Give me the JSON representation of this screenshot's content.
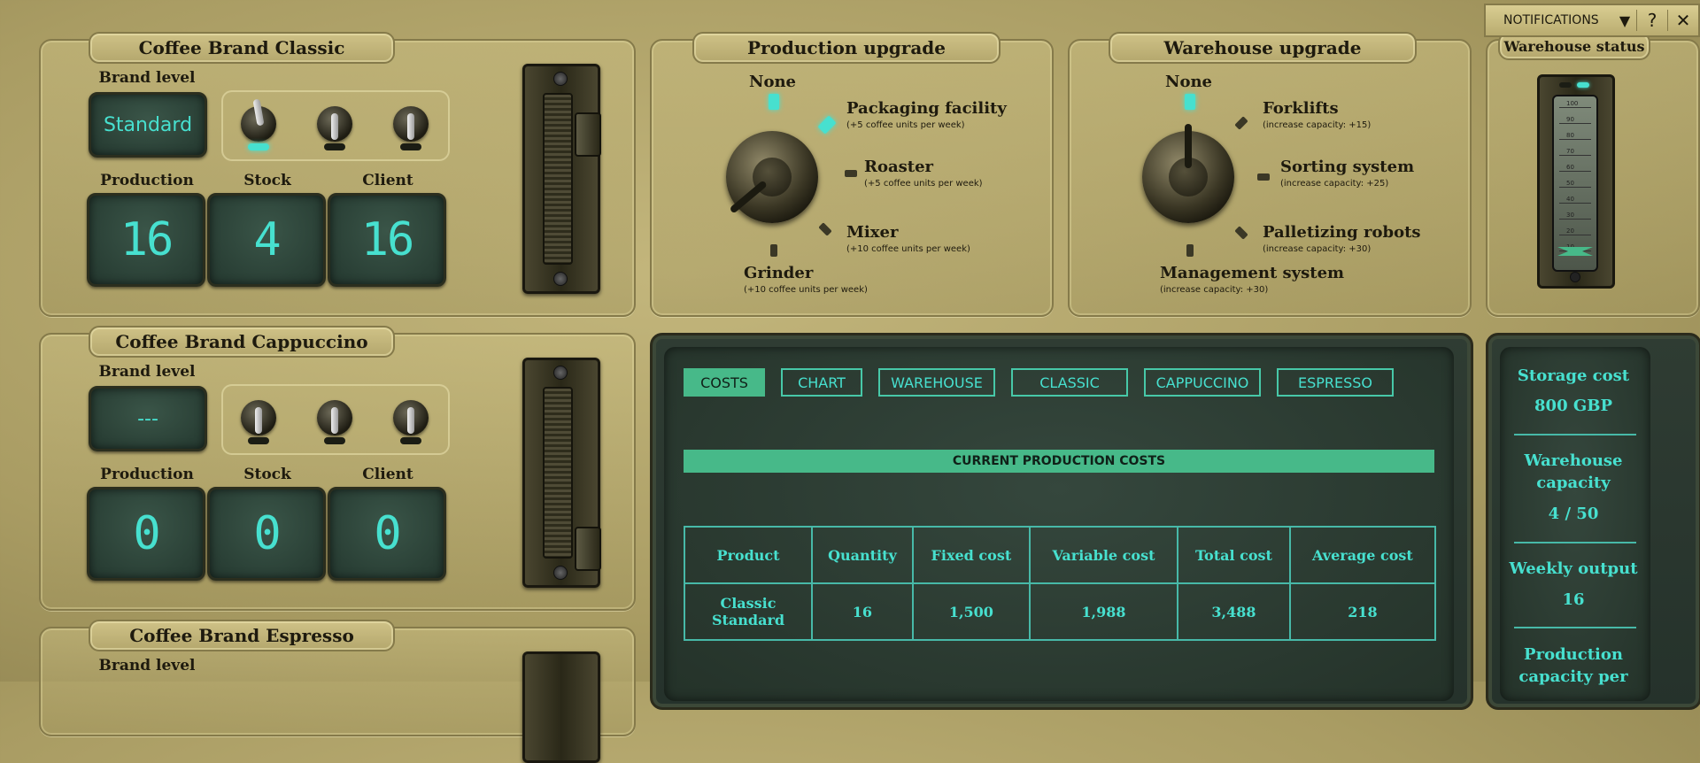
{
  "brands": [
    {
      "title": "Coffee Brand Classic",
      "brand_level_label": "Brand level",
      "brand_level": "Standard",
      "production_label": "Production",
      "stock_label": "Stock",
      "client_label": "Client",
      "production": "16",
      "stock": "4",
      "client": "16"
    },
    {
      "title": "Coffee Brand Cappuccino",
      "brand_level_label": "Brand level",
      "brand_level": "---",
      "production_label": "Production",
      "stock_label": "Stock",
      "client_label": "Client",
      "production": "0",
      "stock": "0",
      "client": "0"
    },
    {
      "title": "Coffee Brand Espresso",
      "brand_level_label": "Brand level"
    }
  ],
  "production_upgrade": {
    "title": "Production upgrade",
    "options": [
      {
        "name": "None",
        "sub": ""
      },
      {
        "name": "Packaging facility",
        "sub": "(+5 coffee units per week)"
      },
      {
        "name": "Roaster",
        "sub": "(+5 coffee units per week)"
      },
      {
        "name": "Mixer",
        "sub": "(+10 coffee units per week)"
      },
      {
        "name": "Grinder",
        "sub": "(+10 coffee units per week)"
      }
    ]
  },
  "warehouse_upgrade": {
    "title": "Warehouse upgrade",
    "options": [
      {
        "name": "None",
        "sub": ""
      },
      {
        "name": "Forklifts",
        "sub": "(increase capacity: +15)"
      },
      {
        "name": "Sorting system",
        "sub": "(increase capacity: +25)"
      },
      {
        "name": "Palletizing robots",
        "sub": "(increase capacity: +30)"
      },
      {
        "name": "Management system",
        "sub": "(increase capacity: +30)"
      }
    ]
  },
  "warehouse_status": {
    "title": "Warehouse status",
    "scale": [
      "100",
      "90",
      "80",
      "70",
      "60",
      "50",
      "40",
      "30",
      "20",
      "10"
    ]
  },
  "notifications": {
    "label": "NOTIFICATIONS",
    "help": "?",
    "close": "✕"
  },
  "tabs": [
    "COSTS",
    "CHART",
    "WAREHOUSE",
    "CLASSIC",
    "CAPPUCCINO",
    "ESPRESSO"
  ],
  "costs": {
    "banner": "CURRENT PRODUCTION COSTS",
    "headers": [
      "Product",
      "Quantity",
      "Fixed cost",
      "Variable cost",
      "Total cost",
      "Average cost"
    ],
    "rows": [
      [
        "Classic Standard",
        "16",
        "1,500",
        "1,988",
        "3,488",
        "218"
      ]
    ]
  },
  "stats": {
    "storage_cost_label": "Storage cost",
    "storage_cost": "800 GBP",
    "warehouse_capacity_label": "Warehouse capacity",
    "warehouse_capacity": "4 / 50",
    "weekly_output_label": "Weekly output",
    "weekly_output": "16",
    "production_capacity_label": "Production capacity per"
  },
  "colors": {
    "accent": "#47e0cf",
    "active_tab": "#47b989",
    "panel": "#b4a76d"
  }
}
